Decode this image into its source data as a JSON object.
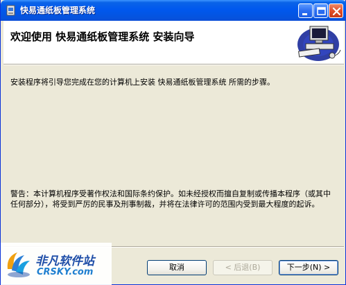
{
  "window": {
    "title": "快易通纸板管理系统"
  },
  "header": {
    "title": "欢迎使用 快易通纸板管理系统 安装向导"
  },
  "body": {
    "intro": "安装程序将引导您完成在您的计算机上安装 快易通纸板管理系统 所需的步骤。",
    "warning": "警告：本计算机程序受著作权法和国际条约保护。如未经授权而擅自复制或传播本程序（或其中任何部分），将受到严厉的民事及刑事制裁，并将在法律许可的范围内受到最大程度的起诉。"
  },
  "buttons": {
    "cancel": "取消",
    "back": "< 后退(B)",
    "next": "下一步(N) >"
  },
  "watermark": {
    "line1": "非凡软件站",
    "line2": "CRSKY.com"
  },
  "colors": {
    "titlebar": "#0058ee",
    "dialog_bg": "#ece9d8",
    "header_bg": "#ffffff"
  },
  "icons": {
    "app": "installer-icon",
    "header_graphic": "computer-icon"
  }
}
